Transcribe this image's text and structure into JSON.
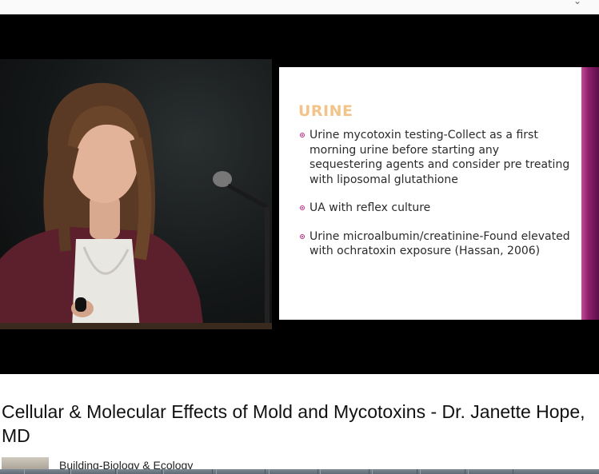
{
  "slide": {
    "heading": "URINE",
    "bullets": [
      "Urine mycotoxin testing-Collect as a first morning urine before starting any sequestering agents and consider pre treating with liposomal glutathione",
      "UA with reflex culture",
      "Urine microalbumin/creatinine-Found elevated with ochratoxin exposure (Hassan, 2006)"
    ],
    "accent_color": "#c2267f",
    "heading_color": "#f2c48a"
  },
  "video": {
    "title": "Cellular & Molecular Effects of Mold and Mycotoxins - Dr. Janette Hope, MD",
    "channel": "Building-Biology & Ecology"
  },
  "icons": {
    "dropdown": "chevron-down-icon",
    "bullet": "bullet-circle-icon"
  }
}
